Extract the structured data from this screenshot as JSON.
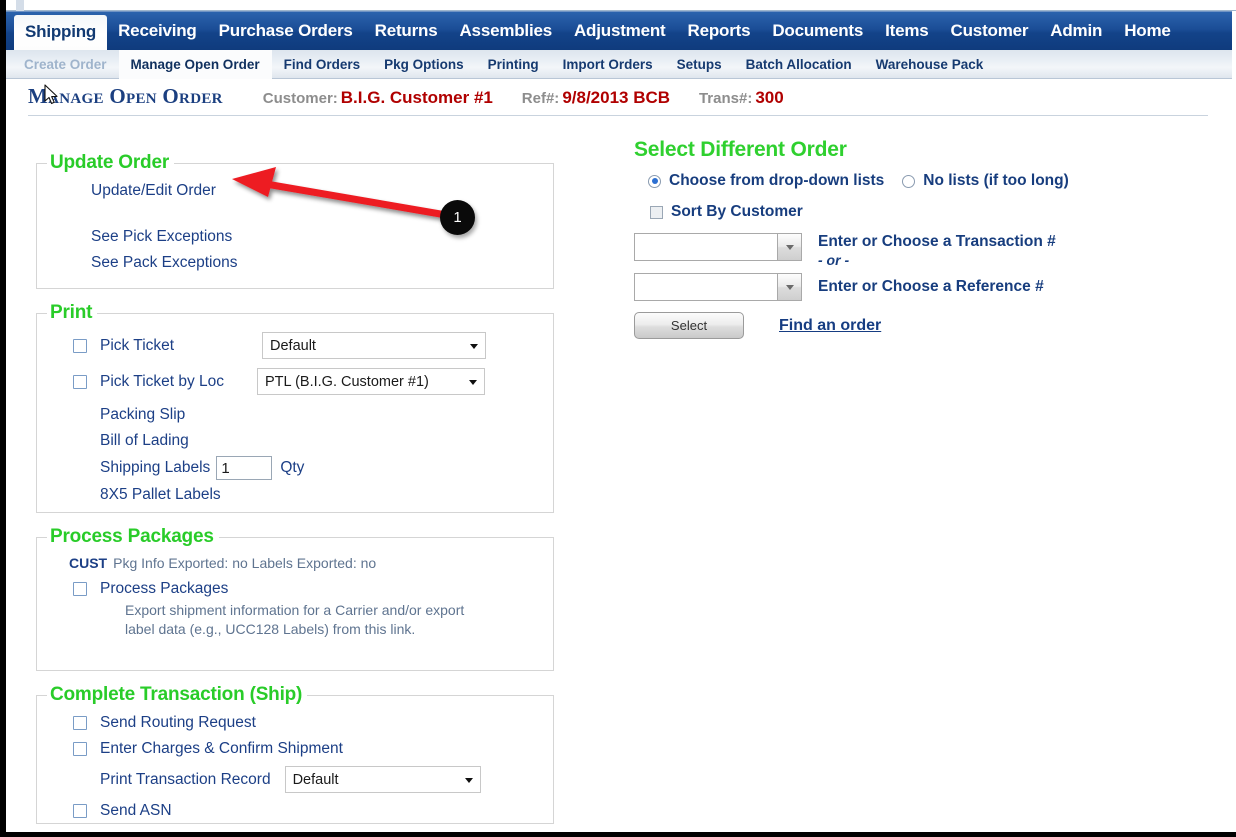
{
  "mainnav": {
    "items": [
      {
        "label": "Shipping",
        "active": true
      },
      {
        "label": "Receiving",
        "active": false
      },
      {
        "label": "Purchase Orders",
        "active": false
      },
      {
        "label": "Returns",
        "active": false
      },
      {
        "label": "Assemblies",
        "active": false
      },
      {
        "label": "Adjustment",
        "active": false
      },
      {
        "label": "Reports",
        "active": false
      },
      {
        "label": "Documents",
        "active": false
      },
      {
        "label": "Items",
        "active": false
      },
      {
        "label": "Customer",
        "active": false
      },
      {
        "label": "Admin",
        "active": false
      },
      {
        "label": "Home",
        "active": false
      }
    ]
  },
  "subnav": {
    "items": [
      {
        "label": "Create Order",
        "state": "disabled"
      },
      {
        "label": "Manage Open Order",
        "state": "active"
      },
      {
        "label": "Find Orders",
        "state": "normal"
      },
      {
        "label": "Pkg Options",
        "state": "normal"
      },
      {
        "label": "Printing",
        "state": "normal"
      },
      {
        "label": "Import Orders",
        "state": "normal"
      },
      {
        "label": "Setups",
        "state": "normal"
      },
      {
        "label": "Batch Allocation",
        "state": "normal"
      },
      {
        "label": "Warehouse Pack",
        "state": "normal"
      }
    ]
  },
  "header": {
    "title": "Manage Open Order",
    "customer_label": "Customer:",
    "customer_value": "B.I.G. Customer #1",
    "ref_label": "Ref#:",
    "ref_value": "9/8/2013 BCB",
    "trans_label": "Trans#:",
    "trans_value": "300"
  },
  "update_order": {
    "legend": "Update Order",
    "links": [
      "Update/Edit Order",
      "See Pick Exceptions",
      "See Pack Exceptions"
    ]
  },
  "print": {
    "legend": "Print",
    "pick_ticket_label": "Pick Ticket",
    "pick_ticket_value": "Default",
    "pick_ticket_loc_label": "Pick Ticket by Loc",
    "pick_ticket_loc_value": "PTL (B.I.G. Customer #1)",
    "packing_slip_label": "Packing Slip",
    "bill_of_lading_label": "Bill of Lading",
    "shipping_labels_label": "Shipping Labels",
    "shipping_labels_qty": "1",
    "qty_label": "Qty",
    "pallet_labels_label": "8X5 Pallet Labels"
  },
  "process_packages": {
    "legend": "Process Packages",
    "cust_tag": "CUST",
    "status_text": "Pkg Info Exported: no Labels Exported: no",
    "checkbox_label": "Process Packages",
    "description": "Export shipment information for a Carrier and/or export label data (e.g., UCC128 Labels) from this link."
  },
  "complete_transaction": {
    "legend": "Complete Transaction (Ship)",
    "send_routing_label": "Send Routing Request",
    "enter_charges_label": "Enter Charges & Confirm Shipment",
    "print_record_label": "Print Transaction Record",
    "print_record_value": "Default",
    "send_asn_label": "Send ASN"
  },
  "select_order": {
    "heading": "Select Different Order",
    "radio_dropdown_label": "Choose from drop-down lists",
    "radio_nolists_label": "No lists (if too long)",
    "sort_by_customer_label": "Sort By Customer",
    "transaction_value": "",
    "transaction_label": "Enter or Choose a Transaction #",
    "or_label": "- or -",
    "reference_value": "",
    "reference_label": "Enter or Choose a Reference #",
    "select_button": "Select",
    "find_link": "Find an order"
  },
  "annotation": {
    "badge_number": "1",
    "color": "#ED1B24"
  }
}
